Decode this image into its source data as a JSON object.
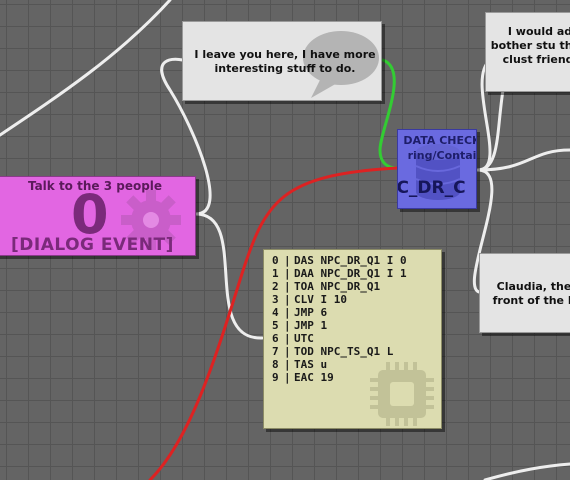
{
  "canvas": {
    "grid_color": "#555555",
    "background": "#646464",
    "connection_colors": {
      "default": "#eeeeee",
      "true": "#33cc33",
      "false": "#dd2222"
    }
  },
  "dialog_nodes": [
    {
      "id": "dialog-leave",
      "text": "I leave you here, I have more interesting stuff to do."
    },
    {
      "id": "dialog-advice",
      "text": "I would ad bother stu their clust friendl"
    },
    {
      "id": "dialog-claudia",
      "text": "Claudia, the front of the li"
    }
  ],
  "event_node": {
    "title": "Talk to the 3 people",
    "count": "0",
    "kind": "[DIALOG EVENT]",
    "icon": "gear-icon",
    "color": "#e266e2"
  },
  "data_node": {
    "title": "DATA CHECK",
    "subtitle": "ring/Contai",
    "key": "PC_DR_C",
    "icon": "database-icon",
    "color": "#6a6ae0"
  },
  "script_node": {
    "icon": "chip-icon",
    "color": "#dcdcb0",
    "lines": [
      {
        "num": "0",
        "sep": "|",
        "code": "DAS NPC_DR_Q1 I 0"
      },
      {
        "num": "1",
        "sep": "|",
        "code": "DAA NPC_DR_Q1 I 1"
      },
      {
        "num": "2",
        "sep": "|",
        "code": "TOA NPC_DR_Q1"
      },
      {
        "num": "3",
        "sep": "|",
        "code": "CLV I 10"
      },
      {
        "num": "4",
        "sep": "|",
        "code": "JMP 6"
      },
      {
        "num": "5",
        "sep": "|",
        "code": "JMP 1"
      },
      {
        "num": "6",
        "sep": "|",
        "code": "UTC"
      },
      {
        "num": "7",
        "sep": "|",
        "code": "TOD NPC_TS_Q1 L"
      },
      {
        "num": "8",
        "sep": "|",
        "code": "TAS u"
      },
      {
        "num": "9",
        "sep": "|",
        "code": "EAC 19"
      }
    ]
  }
}
